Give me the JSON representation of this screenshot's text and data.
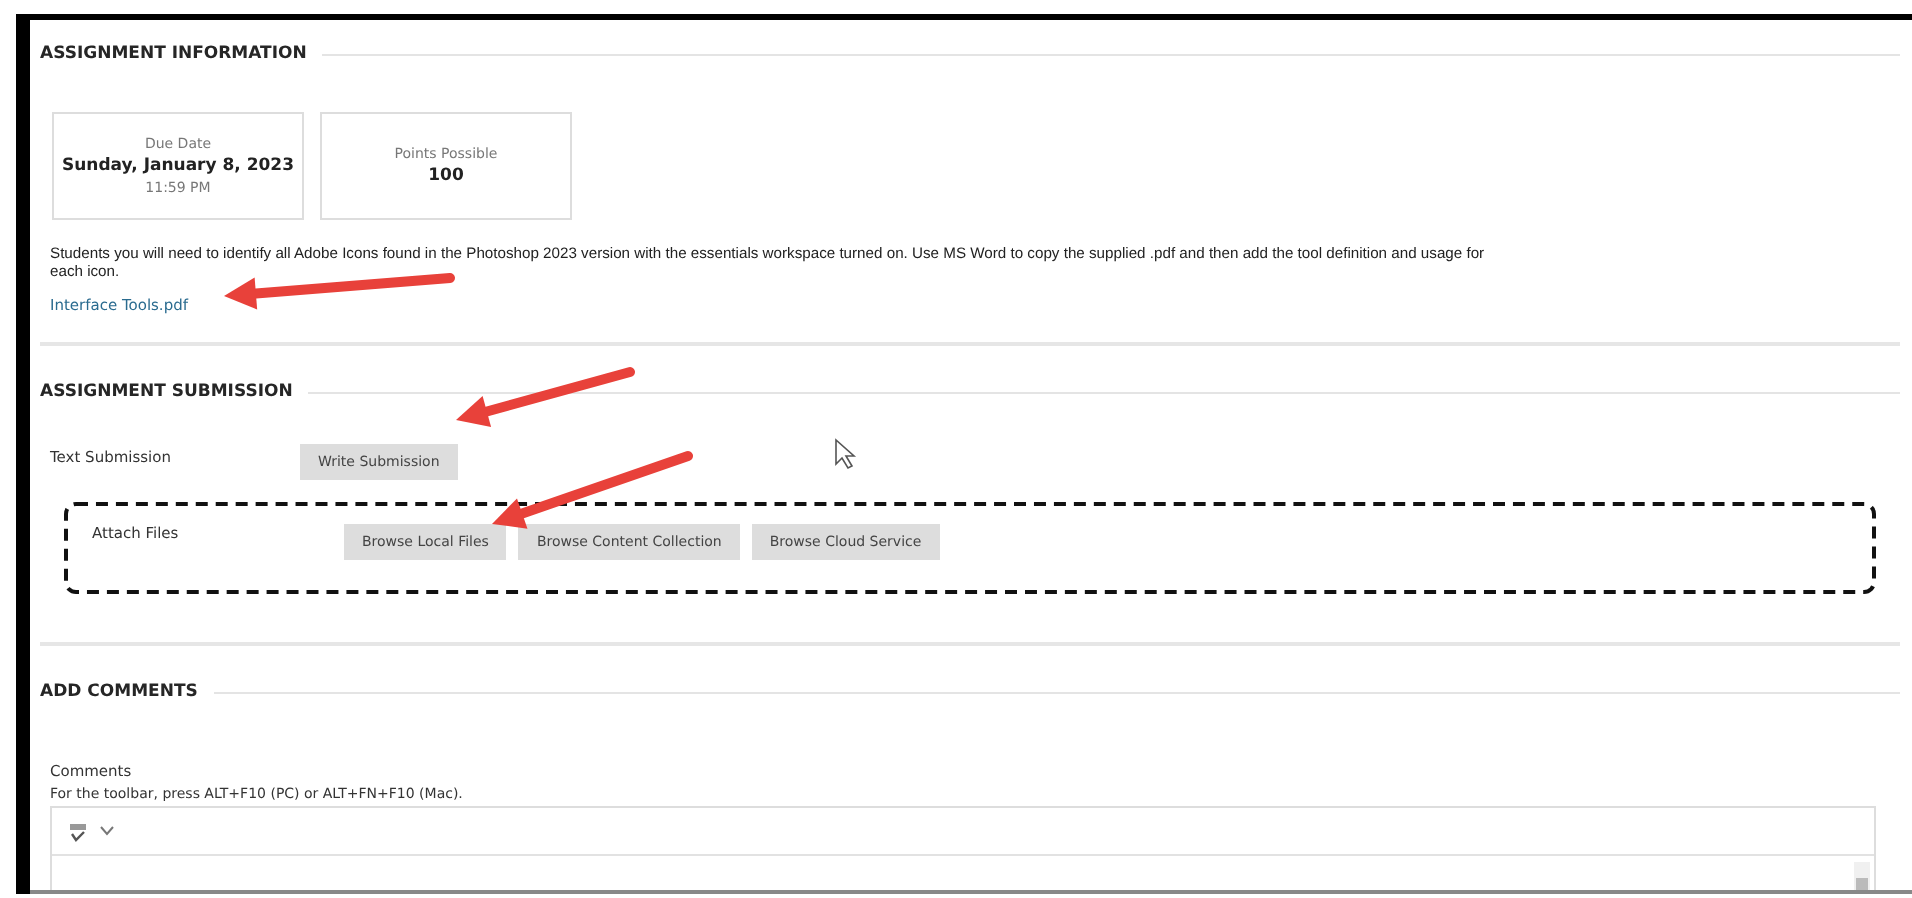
{
  "sections": [
    {
      "kind": "info",
      "heading": "ASSIGNMENT INFORMATION",
      "cards": [
        {
          "label": "Due Date",
          "value": "Sunday, January 8, 2023",
          "detail": "11:59 PM"
        },
        {
          "label": "Points Possible",
          "value": "100"
        }
      ],
      "instructions": "Students you will need to identify all Adobe Icons found in the Photoshop 2023 version with the essentials workspace turned on. Use MS Word to copy the supplied .pdf and then add the tool definition and usage for each icon.",
      "attachment": "Interface Tools.pdf"
    },
    {
      "kind": "submission",
      "heading": "ASSIGNMENT SUBMISSION",
      "rows": [
        {
          "label": "Text Submission",
          "highlighted": false,
          "buttons": [
            "Write Submission"
          ]
        },
        {
          "label": "Attach Files",
          "highlighted": true,
          "buttons": [
            "Browse Local Files",
            "Browse Content Collection",
            "Browse Cloud Service"
          ]
        }
      ]
    },
    {
      "kind": "comments",
      "heading": "ADD COMMENTS",
      "label": "Comments",
      "hint": "For the toolbar, press ALT+F10 (PC) or ALT+FN+F10 (Mac)."
    }
  ]
}
